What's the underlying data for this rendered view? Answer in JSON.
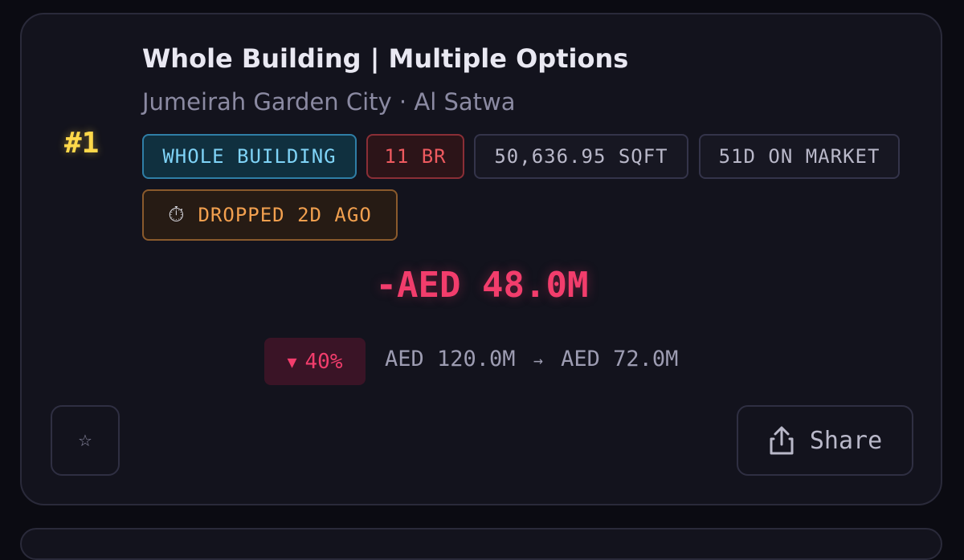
{
  "listing": {
    "rank": "#1",
    "title": "Whole Building | Multiple Options",
    "location": "Jumeirah Garden City · Al Satwa",
    "badges": {
      "property_type": "WHOLE BUILDING",
      "bedrooms": "11 BR",
      "size": "50,636.95 SQFT",
      "days_on_market": "51D ON MARKET",
      "dropped": "DROPPED 2D AGO"
    },
    "icons": {
      "dropped": "stopwatch-icon",
      "favorite": "star-outline-icon",
      "share": "share-upload-icon",
      "price_direction": "down-triangle-icon"
    },
    "price_drop_amount": "-AED 48.0M",
    "price_drop_percent": "40%",
    "price_old": "AED 120.0M",
    "price_new": "AED 72.0M"
  },
  "actions": {
    "share_label": "Share"
  },
  "colors": {
    "background": "#0b0b12",
    "card": "#13131d",
    "rank": "#ffd84a",
    "drop": "#f23d6c",
    "type_badge": "#7fd3f7",
    "br_badge": "#ee5a5f",
    "dropped_badge": "#f2a04f"
  }
}
